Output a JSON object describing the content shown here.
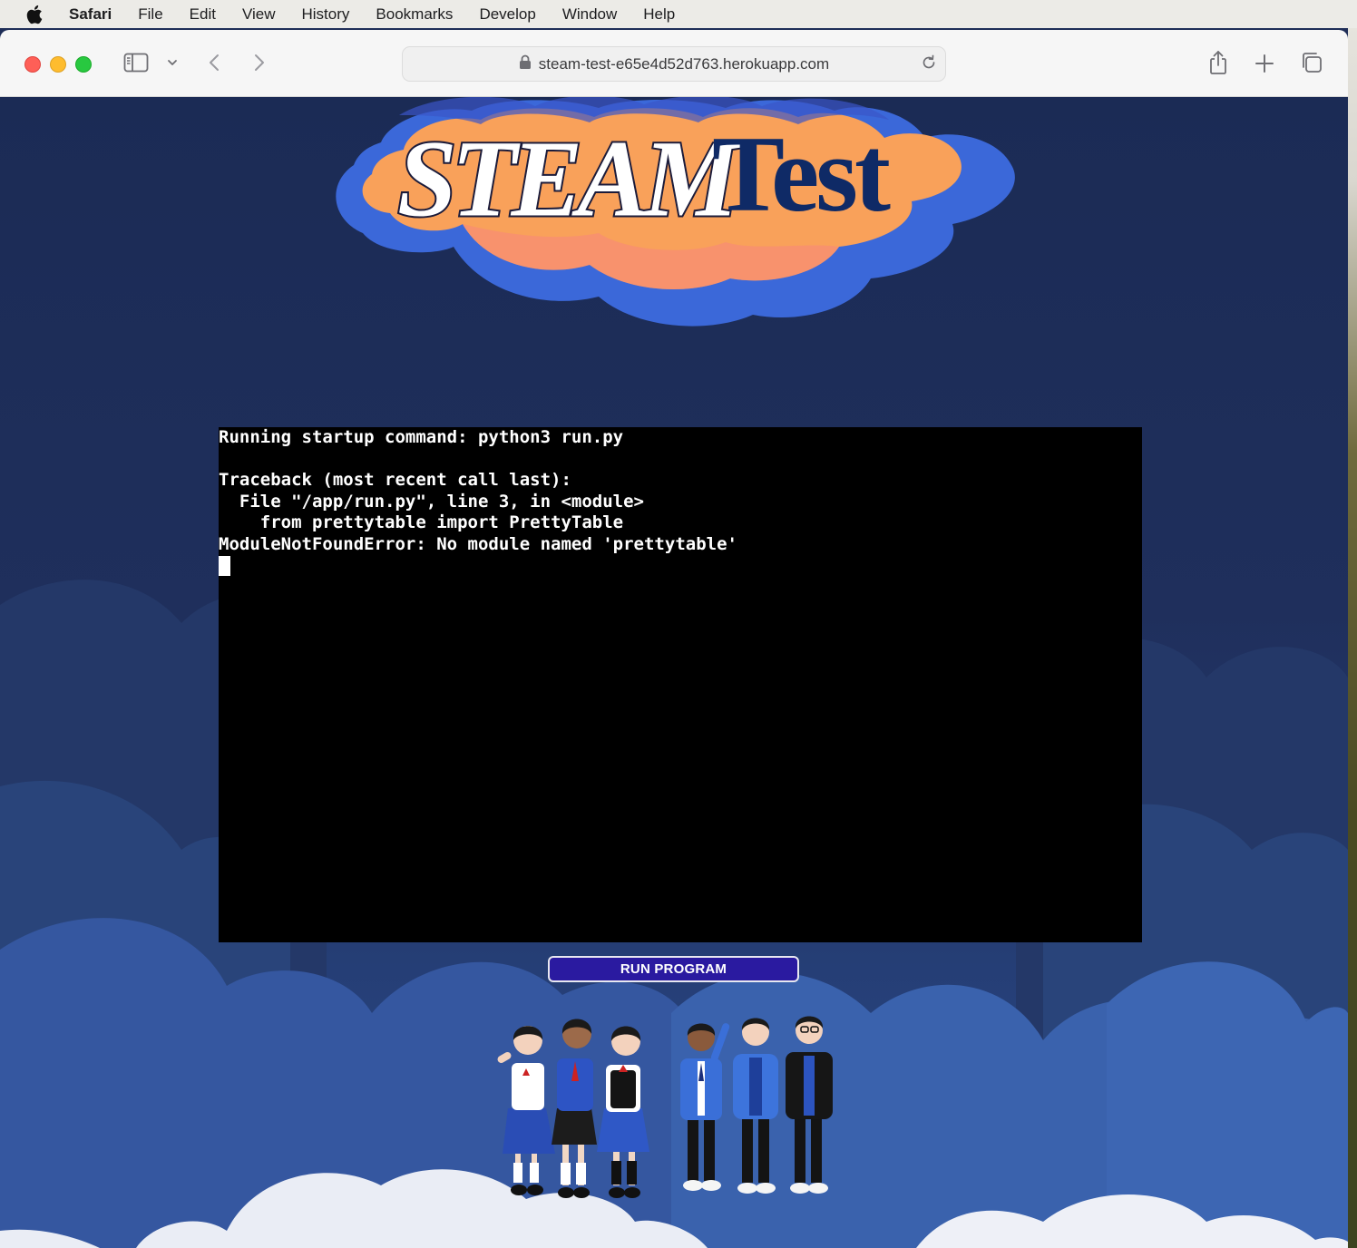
{
  "menubar": {
    "app_name": "Safari",
    "items": [
      "File",
      "Edit",
      "View",
      "History",
      "Bookmarks",
      "Develop",
      "Window",
      "Help"
    ]
  },
  "browser": {
    "url": "steam-test-e65e4d52d763.herokuapp.com"
  },
  "page": {
    "logo_text_left": "STEAM",
    "logo_text_right": "Test",
    "terminal_lines": [
      "Running startup command: python3 run.py",
      "",
      "Traceback (most recent call last):",
      "  File \"/app/run.py\", line 3, in <module>",
      "    from prettytable import PrettyTable",
      "ModuleNotFoundError: No module named 'prettytable'"
    ],
    "run_button_label": "RUN PROGRAM"
  },
  "colors": {
    "page_background": "#1e2d57",
    "button_background": "#2a1aa0",
    "logo_cloud_orange": "#f9a15a",
    "logo_cloud_blue": "#3b68d9"
  }
}
